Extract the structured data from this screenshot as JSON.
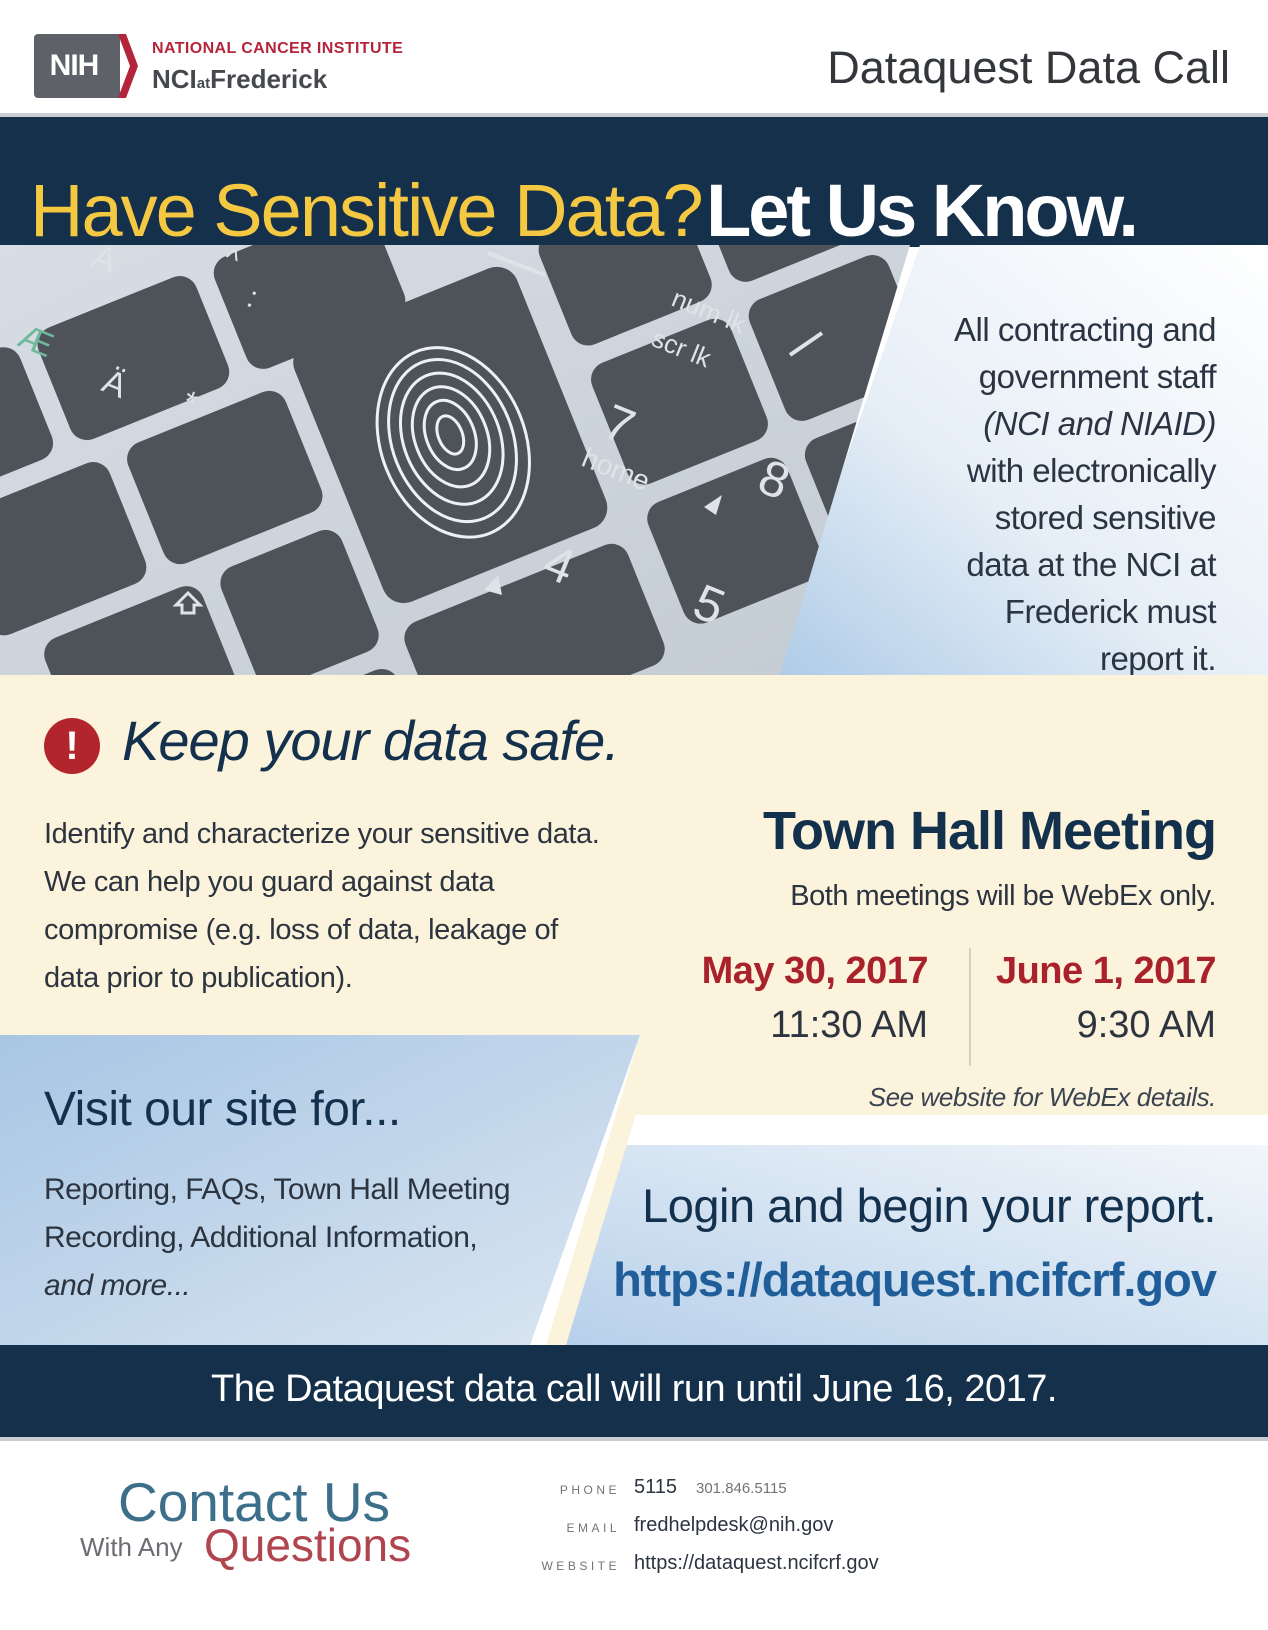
{
  "header": {
    "logo_badge": "NIH",
    "org_top": "NATIONAL CANCER INSTITUTE",
    "org_bottom_pre": "NCI",
    "org_bottom_at": "at",
    "org_bottom_post": "Frederick",
    "doc_title": "Dataquest Data Call"
  },
  "headline": {
    "question": "Have Sensitive Data?",
    "call": "Let Us Know."
  },
  "intro_panel": {
    "line1": "All contracting and",
    "line2": "government staff",
    "line3": "(NCI and NIAID)",
    "line4": "with electronically",
    "line5": "stored sensitive",
    "line6": "data at the NCI at",
    "line7": "Frederick must",
    "line8": "report it."
  },
  "keyboard_keys": {
    "num_lk": "num lk",
    "scr_lk": "scr lk",
    "seven": "7",
    "home": "home",
    "eight": "8",
    "four": "4",
    "five": "5",
    "a_umlaut": "Ä",
    "ae": "Æ",
    "a_grave": "À",
    "caret": "^",
    "star": "*",
    "colon": ":"
  },
  "keep_safe": {
    "icon": "alert-circle-icon",
    "title": "Keep your data safe.",
    "body_line1": "Identify and characterize your sensitive data.",
    "body_line2": "We can help you guard against data",
    "body_line3": "compromise (e.g. loss of data, leakage of",
    "body_line4": "data prior to publication)."
  },
  "town_hall": {
    "title": "Town Hall Meeting",
    "subtitle": "Both meetings will be WebEx only.",
    "meetings": [
      {
        "date": "May 30, 2017",
        "time": "11:30 AM"
      },
      {
        "date": "June 1, 2017",
        "time": "9:30 AM"
      }
    ],
    "note": "See website for WebEx details."
  },
  "visit": {
    "title": "Visit our site for...",
    "line1": "Reporting, FAQs, Town Hall Meeting",
    "line2": "Recording, Additional Information,",
    "line3": "and more..."
  },
  "login": {
    "text": "Login and begin your report.",
    "url": "https://dataquest.ncifcrf.gov"
  },
  "deadline": "The Dataquest data call will run until June 16, 2017.",
  "contact": {
    "title": "Contact Us",
    "with_any": "With Any",
    "questions": "Questions",
    "phone_label": "PHONE",
    "phone_ext": "5115",
    "phone_full": "301.846.5115",
    "email_label": "EMAIL",
    "email": "fredhelpdesk@nih.gov",
    "website_label": "WEBSITE",
    "website": "https://dataquest.ncifcrf.gov"
  },
  "colors": {
    "navy": "#15304a",
    "headline_yellow": "#f5c842",
    "date_red": "#a9222b",
    "link_blue": "#1f5e99",
    "cream": "#fcf3dc",
    "accent_red": "#b3253a"
  }
}
